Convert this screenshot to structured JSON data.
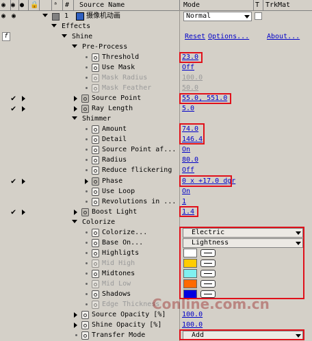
{
  "header": {
    "hash": "#",
    "source_name": "Source Name",
    "mode": "Mode",
    "t": "T",
    "trkmat": "TrkMat"
  },
  "layer": {
    "number": "1",
    "name": "摄像机动画",
    "mode": "Normal"
  },
  "effects_label": "Effects",
  "shine": {
    "label": "Shine",
    "reset": "Reset",
    "options": "Options...",
    "about": "About..."
  },
  "params": {
    "pre_process": "Pre-Process",
    "threshold": {
      "label": "Threshold",
      "value": "23.0"
    },
    "use_mask": {
      "label": "Use Mask",
      "value": "Off"
    },
    "mask_radius": {
      "label": "Mask Radius",
      "value": "100.0"
    },
    "mask_feather": {
      "label": "Mask Feather",
      "value": "50.0"
    },
    "source_point": {
      "label": "Source Point",
      "value": "55.0, 551.0"
    },
    "ray_length": {
      "label": "Ray Length",
      "value": "5.0"
    },
    "shimmer": "Shimmer",
    "amount": {
      "label": "Amount",
      "value": "74.0"
    },
    "detail": {
      "label": "Detail",
      "value": "146.4"
    },
    "source_point_aff": {
      "label": "Source Point af...",
      "value": "On"
    },
    "radius": {
      "label": "Radius",
      "value": "80.0"
    },
    "reduce_flickering": {
      "label": "Reduce flickering",
      "value": "Off"
    },
    "phase": {
      "label": "Phase",
      "value": "0 x +17.0 dgr"
    },
    "use_loop": {
      "label": "Use Loop",
      "value": "On"
    },
    "revolutions": {
      "label": "Revolutions in ...",
      "value": "1"
    },
    "boost_light": {
      "label": "Boost Light",
      "value": "1.4"
    },
    "colorize": "Colorize",
    "colorize_opt": {
      "label": "Colorize...",
      "value": "Electric"
    },
    "base_on": {
      "label": "Base On...",
      "value": "Lightness"
    },
    "highlights": {
      "label": "Highligts",
      "color": "#ffffff"
    },
    "mid_high": {
      "label": "Mid High",
      "color": "#ffcc00"
    },
    "midtones": {
      "label": "Midtones",
      "color": "#80f0f0"
    },
    "mid_low": {
      "label": "Mid Low",
      "color": "#ff6a00"
    },
    "shadows": {
      "label": "Shadows",
      "color": "#0000e0"
    },
    "edge_thickness": {
      "label": "Edge Thickness"
    },
    "source_opacity": {
      "label": "Source Opacity [%]",
      "value": "100.0"
    },
    "shine_opacity": {
      "label": "Shine Opacity [%]",
      "value": "100.0"
    },
    "transfer_mode": {
      "label": "Transfer Mode",
      "value": "Add"
    }
  },
  "watermark": "Conline.com.cn",
  "colors": {
    "accent_link": "#0000c8",
    "highlight_box": "#e0101a",
    "panel": "#d4d0c8"
  }
}
